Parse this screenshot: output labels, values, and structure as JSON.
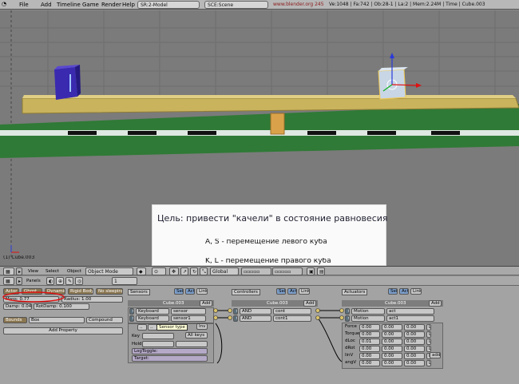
{
  "menu": {
    "items": [
      "File",
      "Add",
      "Timeline",
      "Game",
      "Render",
      "Help"
    ],
    "screen_field": "SR:2-Model",
    "scene_field": "SCE:Scene",
    "url": "www.blender.org 245",
    "stats": "Ve:1048 | Fa:742 | Ob:28-1 | La:2 | Mem:2.24M | Time | Cube.003"
  },
  "viewport": {
    "object_label": "(1) Cube.003",
    "panel": {
      "title": "Цель: привести \"качели\" в состояние равновесия",
      "line1": "A, S - перемещение левого куба",
      "line2": "K, L - перемещение правого куба"
    }
  },
  "header3d": {
    "view": "View",
    "select": "Select",
    "object": "Object",
    "mode": "Object Mode",
    "global": "Global"
  },
  "logic_header": {
    "panels": "Panels",
    "frame": "1"
  },
  "physics": {
    "actor": "Actor",
    "ghost": "Ghost",
    "dynamic": "Dynamic",
    "rigid_body": "Rigid Body",
    "no_sleeping": "No sleeping",
    "mass": "Mass: 0.77",
    "radius": "Radius: 1.00",
    "damp": "Damp: 0.04",
    "rotdamp": "RotDamp: 0.100",
    "bounds": "Bounds",
    "box": "Box",
    "compound": "Compound",
    "add_property": "Add Property"
  },
  "sensors": {
    "title": "Sensors",
    "sel": "Sel",
    "act": "Act",
    "link": "Link",
    "object": "Cube.003",
    "add": "Add",
    "items": [
      {
        "type": "Keyboard",
        "name": "sensor"
      },
      {
        "type": "Keyboard",
        "name": "sensor1"
      }
    ],
    "key_label": "Key",
    "all_keys": "All keys",
    "hold_label": "Hold",
    "log_toggle": "LogToggle:",
    "target": "Target:",
    "tooltip": "Sensor type",
    "inv": "Inv"
  },
  "controllers": {
    "title": "Controllers",
    "sel": "Sel",
    "act": "Act",
    "link": "Link",
    "object": "Cube.003",
    "add": "Add",
    "items": [
      {
        "type": "AND",
        "name": "cont"
      },
      {
        "type": "AND",
        "name": "cont1"
      }
    ]
  },
  "actuators": {
    "title": "Actuators",
    "sel": "Sel",
    "act": "Act",
    "link": "Link",
    "object": "Cube.003",
    "add": "Add",
    "items": [
      {
        "type": "Motion",
        "name": "act"
      },
      {
        "type": "Motion",
        "name": "act1"
      }
    ],
    "rows": [
      {
        "label": "Force",
        "v1": "0.00",
        "v2": "0.00",
        "v3": "0.00",
        "l": "L"
      },
      {
        "label": "Torque",
        "v1": "0.00",
        "v2": "0.00",
        "v3": "0.00",
        "l": "L"
      },
      {
        "label": "dLoc",
        "v1": "0.01",
        "v2": "0.00",
        "v3": "0.00",
        "l": "L"
      },
      {
        "label": "dRot",
        "v1": "0.00",
        "v2": "0.00",
        "v3": "0.00",
        "l": "L"
      },
      {
        "label": "linV",
        "v1": "0.00",
        "v2": "0.00",
        "v3": "0.00",
        "l": "L"
      },
      {
        "label": "angV",
        "v1": "0.00",
        "v2": "0.00",
        "v3": "0.00",
        "l": "L"
      }
    ],
    "add_label": "add"
  },
  "colors": {
    "annotation_red": "#e01010",
    "ground_green": "#2f7a36",
    "seesaw_plank": "#c8b25a",
    "left_cube": "#3a2ab0"
  }
}
